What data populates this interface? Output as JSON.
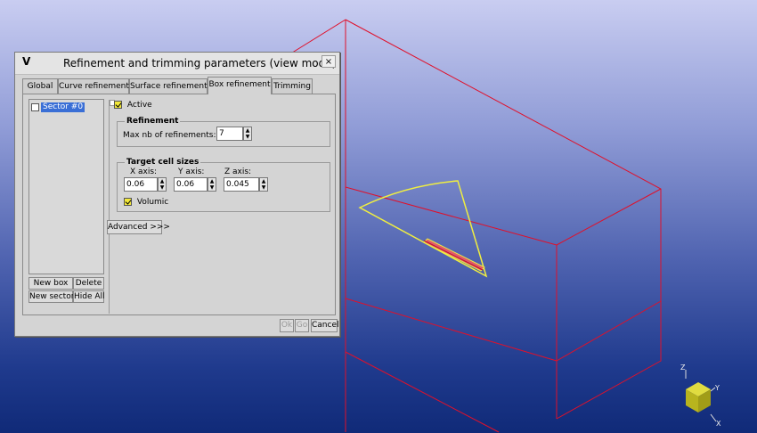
{
  "dialog": {
    "title": "Refinement and trimming parameters  (view mode)",
    "close_glyph": "×",
    "app_icon": "V"
  },
  "tabs": [
    {
      "label": "Global"
    },
    {
      "label": "Curve refinement"
    },
    {
      "label": "Surface refinement"
    },
    {
      "label": "Box refinement",
      "active": true
    },
    {
      "label": "Trimming"
    }
  ],
  "sector_list": {
    "items": [
      {
        "label": "Sector #0",
        "checked": false,
        "selected": true
      }
    ]
  },
  "list_buttons": {
    "new_box": "New box",
    "delete": "Delete",
    "new_sector": "New sector",
    "hide_all": "Hide All"
  },
  "active": {
    "label": "Active",
    "checked": true
  },
  "refinement": {
    "title": "Refinement",
    "max_label": "Max nb of refinements:",
    "max_value": "7"
  },
  "cell_sizes": {
    "title": "Target cell sizes",
    "x_label": "X axis:",
    "x_value": "0.06",
    "y_label": "Y axis:",
    "y_value": "0.06",
    "z_label": "Z axis:",
    "z_value": "0.045",
    "volumic_label": "Volumic",
    "volumic_checked": true
  },
  "advanced_label": "Advanced >>>",
  "footer": {
    "ok": "Ok",
    "go": "Go",
    "cancel": "Cancel"
  },
  "axes": {
    "x": "X",
    "y": "Y",
    "z": "Z"
  },
  "colors": {
    "box_edges": "#e0102a",
    "sector_outline": "#f0ee40",
    "gizmo_cube": "#c8c428"
  }
}
